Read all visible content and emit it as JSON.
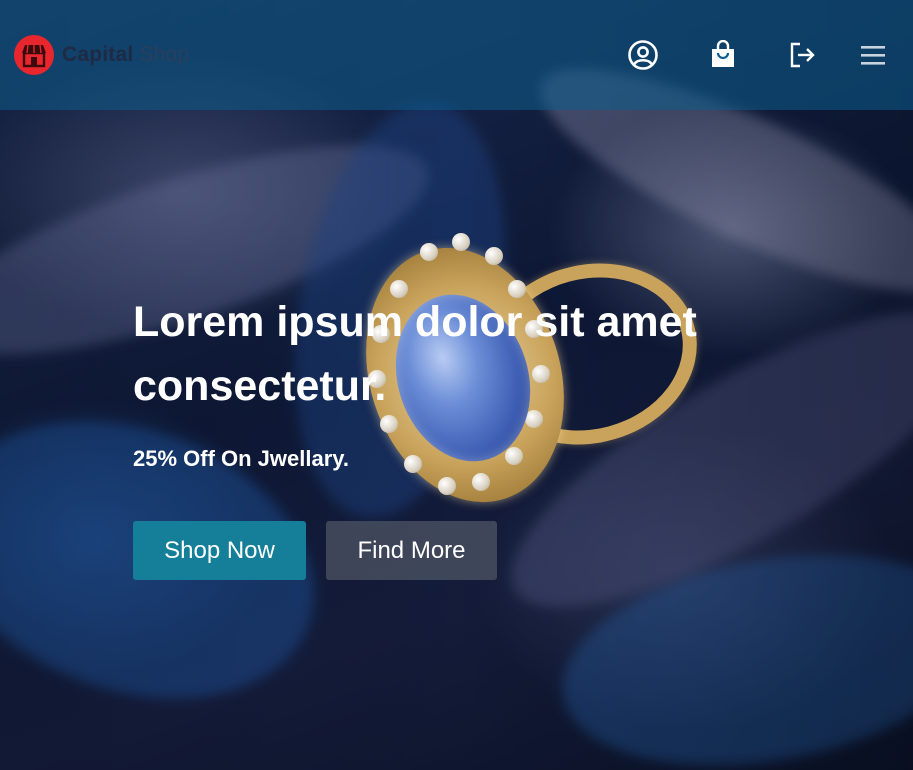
{
  "header": {
    "brand_bold": "Capital",
    "brand_light": "Shop",
    "icons": [
      "user-circle-icon",
      "shopping-bag-icon",
      "logout-icon",
      "hamburger-menu-icon"
    ],
    "logo_color": "#e8262d",
    "bar_color": "#0c5c8c"
  },
  "hero": {
    "headline": "Lorem ipsum dolor sit amet consectetur.",
    "subline": "25% Off On Jwellary.",
    "primary_button": "Shop Now",
    "secondary_button": "Find More",
    "primary_color": "#157f99",
    "secondary_color": "#464e5f"
  }
}
